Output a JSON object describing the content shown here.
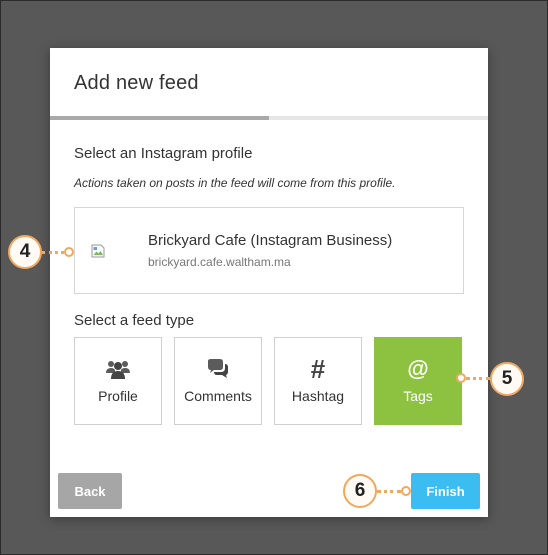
{
  "modal": {
    "title": "Add new feed",
    "progress_percent": 50
  },
  "profile_section": {
    "heading": "Select an Instagram profile",
    "hint": "Actions taken on posts in the feed will come from this profile.",
    "profile": {
      "name": "Brickyard Cafe (Instagram Business)",
      "handle": "brickyard.cafe.waltham.ma"
    }
  },
  "feed_type_section": {
    "heading": "Select a feed type",
    "options": [
      {
        "label": "Profile",
        "icon": "users-icon",
        "selected": false
      },
      {
        "label": "Comments",
        "icon": "comments-icon",
        "selected": false
      },
      {
        "label": "Hashtag",
        "icon": "hashtag-icon",
        "glyph": "#",
        "selected": false
      },
      {
        "label": "Tags",
        "icon": "at-icon",
        "glyph": "@",
        "selected": true
      }
    ]
  },
  "footer": {
    "back_label": "Back",
    "finish_label": "Finish"
  },
  "callouts": [
    "4",
    "5",
    "6"
  ],
  "colors": {
    "selected": "#8cc240",
    "primary": "#3cbdf2",
    "secondary": "#a6a6a6",
    "callout_border": "#f0a860"
  }
}
